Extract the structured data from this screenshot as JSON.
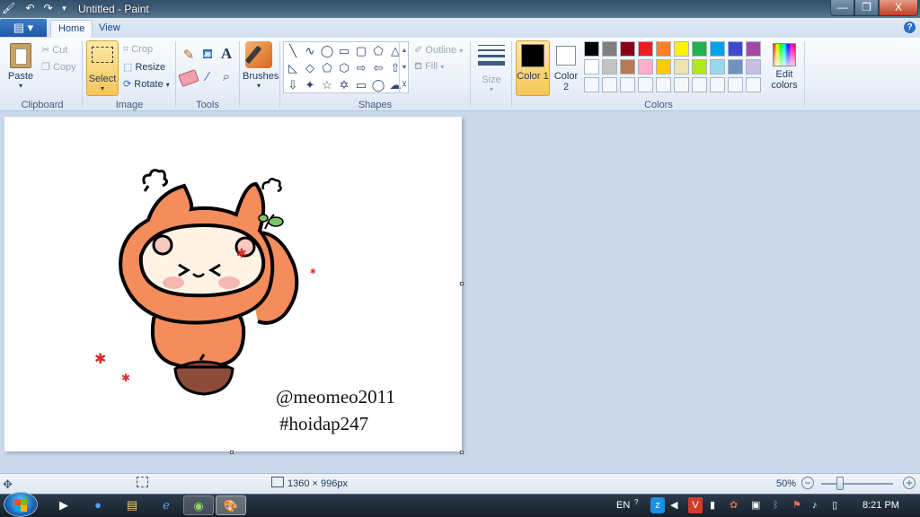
{
  "window": {
    "title": "Untitled - Paint",
    "controls": {
      "minimize": "—",
      "maximize": "❐",
      "close": "X"
    }
  },
  "menu": {
    "file": "▤ ▾"
  },
  "tabs": [
    {
      "label": "Home"
    },
    {
      "label": "View"
    }
  ],
  "help": "?",
  "ribbon": {
    "clipboard": {
      "label": "Clipboard",
      "paste": "Paste",
      "cut": "Cut",
      "copy": "Copy"
    },
    "image": {
      "label": "Image",
      "select": "Select",
      "crop": "Crop",
      "resize": "Resize",
      "rotate": "Rotate"
    },
    "tools": {
      "label": "Tools"
    },
    "brushes": {
      "label": "Brushes"
    },
    "shapes": {
      "label": "Shapes",
      "outline": "Outline",
      "fill": "Fill"
    },
    "size": {
      "label": "Size"
    },
    "colors": {
      "label": "Colors",
      "color1": "Color 1",
      "color1_value": "#000000",
      "color2": "Color 2",
      "color2_value": "#ffffff",
      "edit": "Edit colors",
      "palette_row1": [
        "#000000",
        "#7f7f7f",
        "#880015",
        "#ed1c24",
        "#ff7f27",
        "#fff200",
        "#22b14c",
        "#00a2e8",
        "#3f48cc",
        "#a349a4"
      ],
      "palette_row2": [
        "#ffffff",
        "#c3c3c3",
        "#b97a57",
        "#ffaec9",
        "#ffc90e",
        "#efe4b0",
        "#b5e61d",
        "#99d9ea",
        "#7092be",
        "#c8bfe7"
      ]
    }
  },
  "canvas": {
    "line1": "@meomeo2011",
    "line2": "#hoidap247"
  },
  "status": {
    "dimensions": "1360 × 996px",
    "zoom": "50%"
  },
  "taskbar": {
    "lang": "EN",
    "time": "8:21 PM"
  }
}
